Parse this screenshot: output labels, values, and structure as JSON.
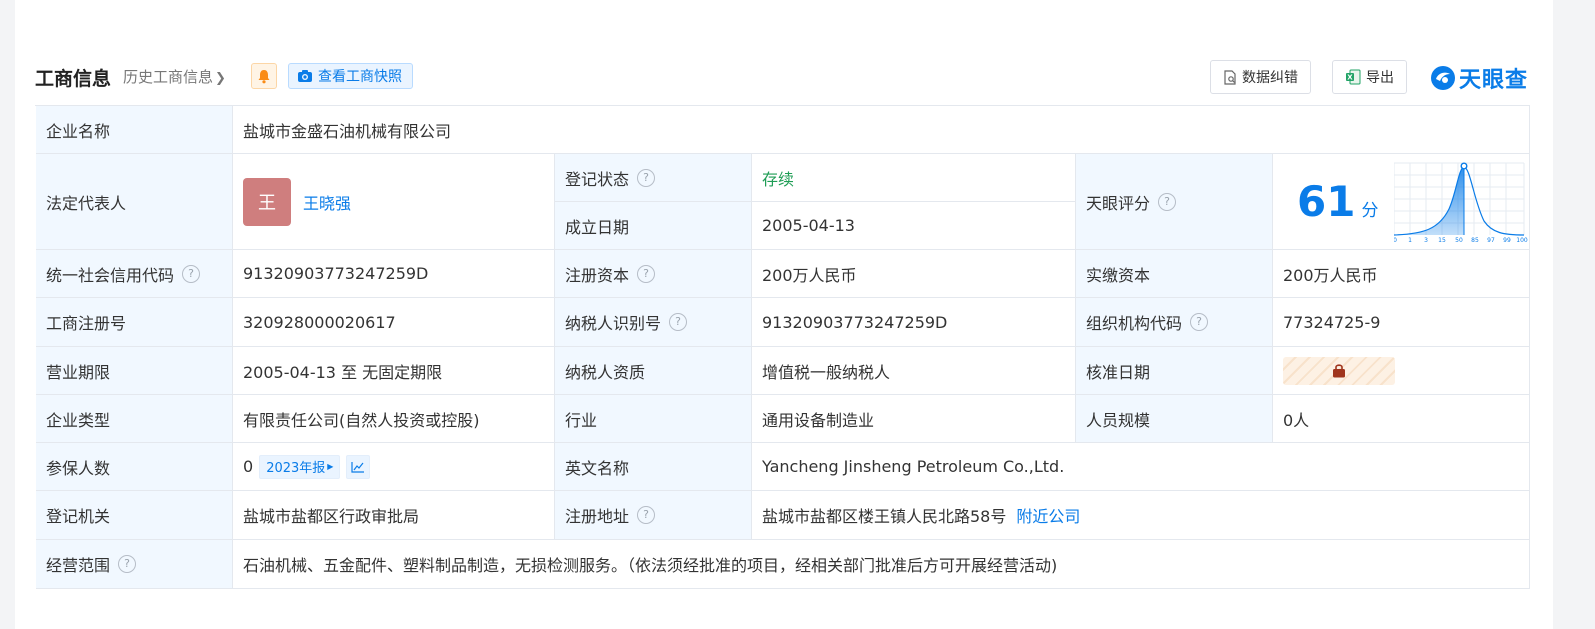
{
  "header": {
    "title": "工商信息",
    "history_link": "历史工商信息",
    "snapshot_button": "查看工商快照",
    "correct_button": "数据纠错",
    "export_button": "导出",
    "logo_text": "天眼查"
  },
  "table": {
    "company_name_label": "企业名称",
    "company_name": "盐城市金盛石油机械有限公司",
    "legal_rep_label": "法定代表人",
    "legal_rep_avatar": "王",
    "legal_rep_name": "王晓强",
    "reg_status_label": "登记状态",
    "reg_status": "存续",
    "founded_label": "成立日期",
    "founded": "2005-04-13",
    "score_label": "天眼评分",
    "score": "61",
    "score_unit": "分",
    "score_axis": [
      "0",
      "1",
      "3",
      "15",
      "50",
      "85",
      "97",
      "99",
      "100"
    ],
    "credit_code_label": "统一社会信用代码",
    "credit_code": "91320903773247259D",
    "reg_capital_label": "注册资本",
    "reg_capital": "200万人民币",
    "paid_capital_label": "实缴资本",
    "paid_capital": "200万人民币",
    "reg_no_label": "工商注册号",
    "reg_no": "320928000020617",
    "taxpayer_id_label": "纳税人识别号",
    "taxpayer_id": "91320903773247259D",
    "org_code_label": "组织机构代码",
    "org_code": "77324725-9",
    "term_label": "营业期限",
    "term": "2005-04-13 至 无固定期限",
    "tax_qual_label": "纳税人资质",
    "tax_qual": "增值税一般纳税人",
    "approval_label": "核准日期",
    "type_label": "企业类型",
    "type": "有限责任公司(自然人投资或控股)",
    "industry_label": "行业",
    "industry": "通用设备制造业",
    "staff_label": "人员规模",
    "staff": "0人",
    "insured_label": "参保人数",
    "insured": "0",
    "insured_report": "2023年报",
    "english_label": "英文名称",
    "english": "Yancheng Jinsheng Petroleum Co.,Ltd.",
    "authority_label": "登记机关",
    "authority": "盐城市盐都区行政审批局",
    "address_label": "注册地址",
    "address": "盐城市盐都区楼王镇人民北路58号",
    "nearby_link": "附近公司",
    "scope_label": "经营范围",
    "scope": "石油机械、五金配件、塑料制品制造，无损检测服务。（依法须经批准的项目，经相关部门批准后方可开展经营活动)"
  },
  "colors": {
    "accent": "#0a7ce8",
    "status_green": "#1f9d55",
    "label_bg": "#f1f8ff",
    "avatar_bg": "#cf7e7e"
  }
}
